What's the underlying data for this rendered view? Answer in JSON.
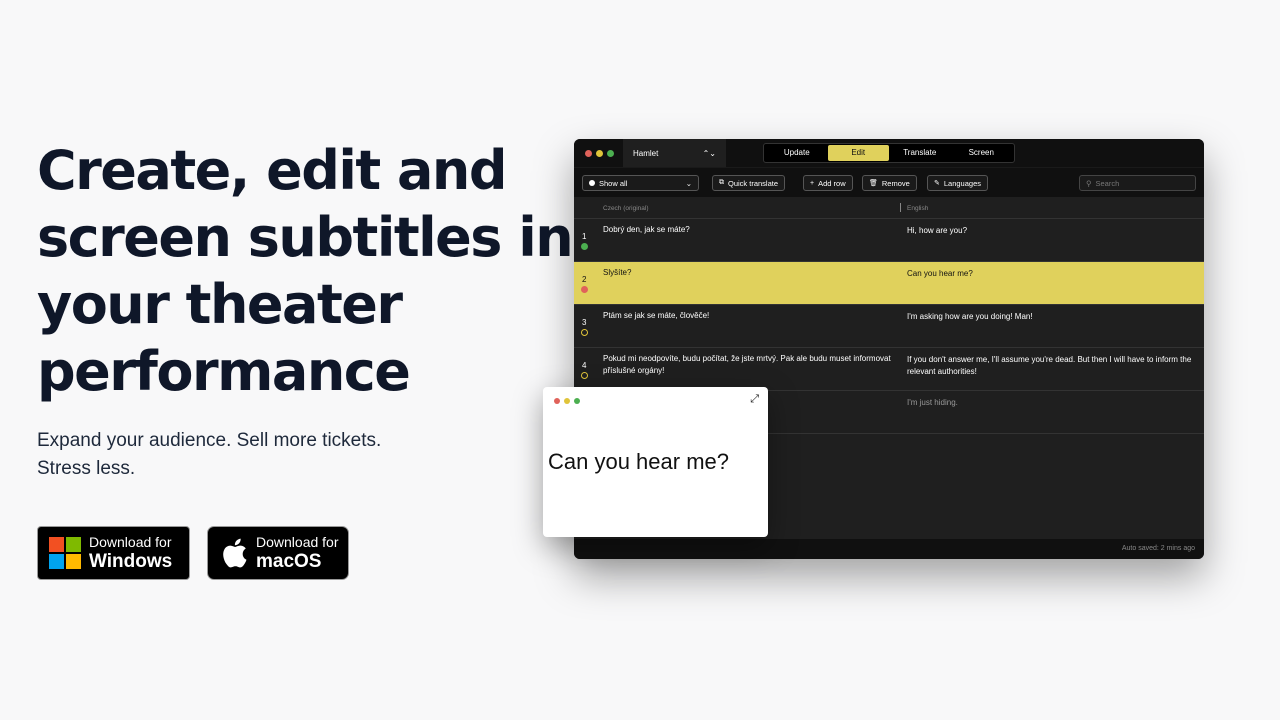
{
  "hero": {
    "title_lines": [
      "Create, edit and",
      "screen subtitles in",
      "your theater",
      "performance"
    ],
    "subtitle_lines": [
      "Expand your audience. Sell more tickets.",
      "Stress less."
    ]
  },
  "downloads": {
    "windows": {
      "small": "Download for",
      "big": "Windows",
      "icon": "windows-logo"
    },
    "macos": {
      "small": "Download for",
      "big": "macOS",
      "icon": "apple-logo"
    }
  },
  "app": {
    "document": "Hamlet",
    "modes": [
      "Update",
      "Edit",
      "Translate",
      "Screen"
    ],
    "active_mode": "Edit",
    "toolbar": {
      "filter": "Show all",
      "quick_translate": "Quick translate",
      "add_row": "Add row",
      "remove": "Remove",
      "languages": "Languages",
      "search_placeholder": "Search"
    },
    "columns": {
      "source": "Czech (original)",
      "target": "English"
    },
    "rows": [
      {
        "num": "1",
        "status": "#4caf50",
        "source": "Dobrý den, jak se máte?",
        "target": "Hi, how are you?"
      },
      {
        "num": "2",
        "status": "#e0625a",
        "source": "Slyšíte?",
        "target": "Can you hear me?"
      },
      {
        "num": "3",
        "status": "#e0c43a",
        "source": "Ptám se jak se máte, člověče!",
        "target": "I'm asking how are you doing! Man!"
      },
      {
        "num": "4",
        "status": "#e0c43a",
        "source": "Pokud mi neodpovíte, budu počítat, že jste mrtvý. Pak ale budu muset informovat příslušné orgány!",
        "target": "If you don't answer me, I'll assume you're dead. But then I will have to inform the relevant authorities!"
      },
      {
        "num": "",
        "status": "",
        "source": "",
        "target": "I'm just hiding."
      }
    ],
    "status_text": "Auto saved: 2 mins ago"
  },
  "preview": {
    "text": "Can you hear me?"
  },
  "colors": {
    "accent": "#e0d15c",
    "red": "#e0625a",
    "yellow": "#e0c43a",
    "green": "#4caf50"
  }
}
